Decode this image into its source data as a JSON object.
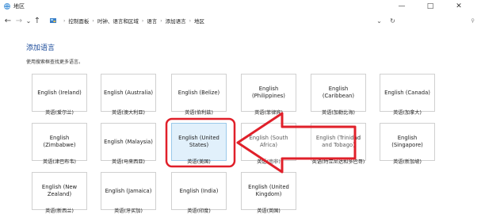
{
  "window": {
    "title": "地区",
    "minimize": "—",
    "maximize": "□",
    "close": "✕"
  },
  "nav": {
    "back": "←",
    "forward": "→",
    "down": "⌄",
    "up": "↑",
    "breadcrumbs": [
      "控制面板",
      "时钟、语言和区域",
      "语言",
      "添加语言",
      "地区"
    ],
    "dropdown_chevron": "⌄",
    "refresh": "↻",
    "search_icon": "⚲"
  },
  "page": {
    "title": "添加语言",
    "subtitle": "使用搜索框查找更多语言。"
  },
  "languages": [
    {
      "name": "English (Ireland)",
      "caption": "英语(爱尔兰)"
    },
    {
      "name": "English (Australia)",
      "caption": "英语(澳大利亚)"
    },
    {
      "name": "English (Belize)",
      "caption": "英语(伯利兹)"
    },
    {
      "name": "English (Philippines)",
      "caption": "英语(菲律宾)"
    },
    {
      "name": "English (Caribbean)",
      "caption": "英语(加勒比海)"
    },
    {
      "name": "English (Canada)",
      "caption": "英语(加拿大)"
    },
    {
      "name": "English (Zimbabwe)",
      "caption": "英语(津巴布韦)"
    },
    {
      "name": "English (Malaysia)",
      "caption": "英语(马来西亚)"
    },
    {
      "name": "English (United States)",
      "caption": "英语(美国)"
    },
    {
      "name": "English (South Africa)",
      "caption": "英语(南非)"
    },
    {
      "name": "English (Trinidad and Tobago)",
      "caption": "英语(特立尼达和多巴哥)"
    },
    {
      "name": "English (Singapore)",
      "caption": "英语(新加坡)"
    },
    {
      "name": "English (New Zealand)",
      "caption": "英语(新西兰)"
    },
    {
      "name": "English (Jamaica)",
      "caption": "英语(牙买加)"
    },
    {
      "name": "English (India)",
      "caption": "英语(印度)"
    },
    {
      "name": "English (United Kingdom)",
      "caption": "英语(英国)"
    }
  ],
  "selected_language": "English (United States)",
  "colors": {
    "heading": "#1a4a9a",
    "selection_fill": "#e1f0fb",
    "annotation_red": "#e0202a"
  }
}
